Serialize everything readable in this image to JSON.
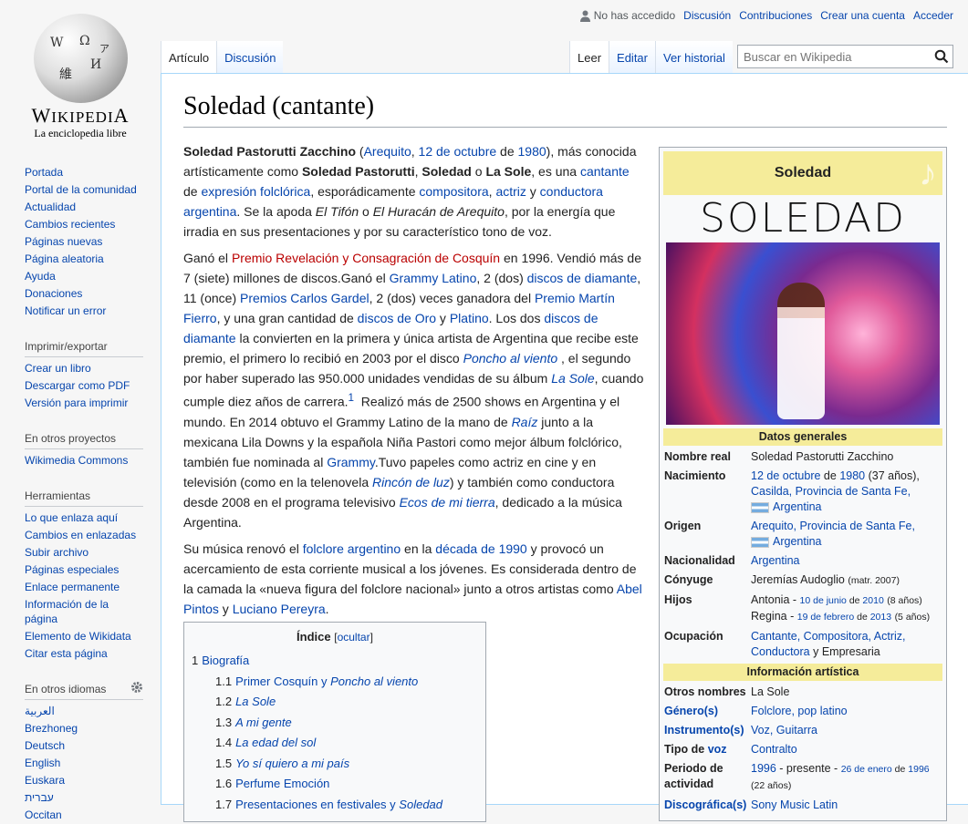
{
  "logo": {
    "wordmark": "Wikipedia",
    "tagline": "La enciclopedia libre"
  },
  "personal": {
    "user": "No has accedido",
    "links": [
      "Discusión",
      "Contribuciones",
      "Crear una cuenta",
      "Acceder"
    ]
  },
  "tabs_left": [
    "Artículo",
    "Discusión"
  ],
  "tabs_right": [
    "Leer",
    "Editar",
    "Ver historial"
  ],
  "search": {
    "placeholder": "Buscar en Wikipedia"
  },
  "sidebar": {
    "nav": [
      "Portada",
      "Portal de la comunidad",
      "Actualidad",
      "Cambios recientes",
      "Páginas nuevas",
      "Página aleatoria",
      "Ayuda",
      "Donaciones",
      "Notificar un error"
    ],
    "print_title": "Imprimir/exportar",
    "print": [
      "Crear un libro",
      "Descargar como PDF",
      "Versión para imprimir"
    ],
    "projects_title": "En otros proyectos",
    "projects": [
      "Wikimedia Commons"
    ],
    "tools_title": "Herramientas",
    "tools": [
      "Lo que enlaza aquí",
      "Cambios en enlazadas",
      "Subir archivo",
      "Páginas especiales",
      "Enlace permanente",
      "Información de la página",
      "Elemento de Wikidata",
      "Citar esta página"
    ],
    "langs_title": "En otros idiomas",
    "langs": [
      "العربية",
      "Brezhoneg",
      "Deutsch",
      "English",
      "Euskara",
      "עברית",
      "Occitan"
    ]
  },
  "title": "Soledad (cantante)",
  "toc": {
    "title": "Índice",
    "hide": "ocultar",
    "entries": [
      {
        "n": "1",
        "t": "Biografía",
        "i": false,
        "sub": false
      },
      {
        "n": "1.1",
        "t": "Primer Cosquín y ",
        "t2": "Poncho al viento",
        "sub": true
      },
      {
        "n": "1.2",
        "t": "La Sole",
        "i": true,
        "sub": true
      },
      {
        "n": "1.3",
        "t": "A mi gente",
        "i": true,
        "sub": true
      },
      {
        "n": "1.4",
        "t": "La edad del sol",
        "i": true,
        "sub": true
      },
      {
        "n": "1.5",
        "t": "Yo sí quiero a mi país",
        "i": true,
        "sub": true
      },
      {
        "n": "1.6",
        "t": "Perfume Emoción",
        "i": false,
        "sub": true
      },
      {
        "n": "1.7",
        "t": "Presentaciones en festivales y ",
        "t2": "Soledad",
        "sub": true
      }
    ]
  },
  "infobox": {
    "title": "Soledad",
    "logo_text": "SOLEDAD",
    "sec1": "Datos generales",
    "sec2": "Información artística",
    "rows1": [
      {
        "k": "Nombre real",
        "v": "Soledad Pastorutti Zacchino"
      },
      {
        "k": "Nacimiento",
        "v_link1": "12 de octubre",
        "v_t1": " de ",
        "v_link2": "1980",
        "v_t2": " (37 años),",
        "v_link3": "Casilda, Provincia de Santa Fe,",
        "v_flag": "Argentina"
      },
      {
        "k": "Origen",
        "v_link": "Arequito, Provincia de Santa Fe,",
        "v_flag": "Argentina"
      },
      {
        "k": "Nacionalidad",
        "v_link": "Argentina"
      },
      {
        "k": "Cónyuge",
        "v": "Jeremías Audoglio",
        "v_small": "(matr. 2007)"
      },
      {
        "k": "Hijos",
        "c1_name": "Antonia",
        "c1_date": "10 de junio",
        "c1_y": "2010",
        "c1_age": "(8 años)",
        "c2_name": "Regina",
        "c2_date": "19 de febrero",
        "c2_y": "2013",
        "c2_age": "(5 años)"
      },
      {
        "k": "Ocupación",
        "v_link": "Cantante, Compositora, Actriz, Conductora",
        "v_t": " y Empresaria"
      }
    ],
    "rows2": [
      {
        "k": "Otros nombres",
        "v": "La Sole"
      },
      {
        "k": "Género(s)",
        "v_link": "Folclore, pop latino"
      },
      {
        "k": "Instrumento(s)",
        "v_link": "Voz, Guitarra"
      },
      {
        "k_t": "Tipo de ",
        "k_link": "voz",
        "v_link": "Contralto"
      },
      {
        "k": "Periodo de actividad",
        "v_link": "1996",
        "v_t": " - presente - ",
        "v_small_link": "26 de enero",
        "v_small_t": " de ",
        "v_small_link2": "1996",
        "v_small2": "(22 años)"
      },
      {
        "k": "Discográfica(s)",
        "v_link": "Sony Music Latin"
      }
    ]
  }
}
